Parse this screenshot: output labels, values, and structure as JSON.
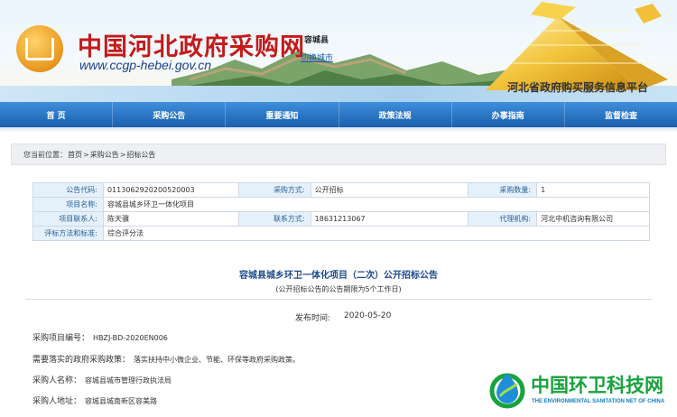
{
  "header": {
    "site_title": "中国河北政府采购网",
    "site_url": "www.ccgp-hebei.gov.cn",
    "city": "容城县",
    "switch_city": "切换城市",
    "platform_name": "河北省政府购买服务信息平台"
  },
  "nav": {
    "items": [
      {
        "label": "首 页"
      },
      {
        "label": "采购公告"
      },
      {
        "label": "重要通知"
      },
      {
        "label": "政策法规"
      },
      {
        "label": "办事指南"
      },
      {
        "label": "监督检查"
      }
    ]
  },
  "breadcrumb": {
    "prefix": "您当前位置：",
    "items": [
      "首页",
      "采购公告",
      "招标公告"
    ],
    "separator": ">"
  },
  "info": {
    "code_label": "公告代码:",
    "code_value": "0113062920200520003",
    "method_label": "采购方式:",
    "method_value": "公开招标",
    "qty_label": "采购数量:",
    "qty_value": "1",
    "project_label": "项目名称:",
    "project_value": "容城县城乡环卫一体化项目",
    "contact_label": "项目联系人:",
    "contact_value": "陈天骥",
    "phone_label": "联系方式:",
    "phone_value": "18631213067",
    "agency_label": "代理机构:",
    "agency_value": "河北中机咨询有限公司",
    "eval_label": "评标方法和标准:",
    "eval_value": "综合评分法"
  },
  "announcement": {
    "title": "容城县城乡环卫一体化项目（二次）公开招标公告",
    "subtitle": "(公开招标公告的公告期限为5个工作日)",
    "date_label": "发布时间:",
    "date_value": "2020-05-20",
    "rows": [
      {
        "label": "采购项目编号：",
        "value": "HBZJ-BD-2020EN006"
      },
      {
        "label": "需要落实的政府采购政策：",
        "value": "落实扶持中小微企业、节能、环保等政府采购政策。"
      },
      {
        "label": "采购人名称：",
        "value": "容城县城市管理行政执法局"
      },
      {
        "label": "采购人地址：",
        "value": "容城县城南新区容美路"
      }
    ]
  },
  "watermark": {
    "title": "中国环卫科技网",
    "subtitle": "THE ENVIRONMENTAL SANITATION NET OF CHINA"
  },
  "colors": {
    "title_red": "#c41a1a",
    "nav_blue": "#1a5fae",
    "label_bg": "#e4f1fb",
    "heading_blue": "#1b4a8a",
    "watermark_green": "#18a23c"
  }
}
